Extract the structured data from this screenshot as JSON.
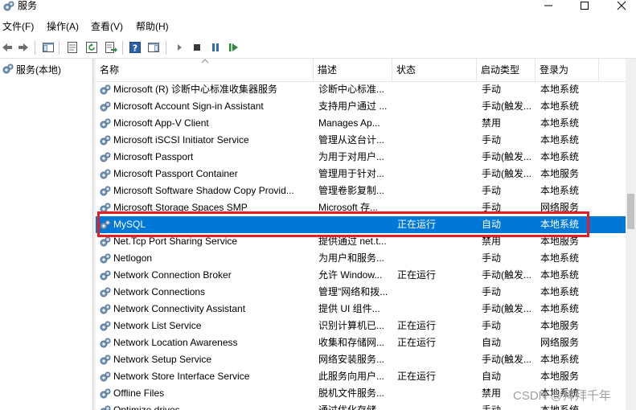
{
  "window": {
    "title": "服务"
  },
  "menu": [
    "文件(F)",
    "操作(A)",
    "查看(V)",
    "帮助(H)"
  ],
  "toolbar": {
    "icons": [
      "back-arrow-icon",
      "forward-arrow-icon",
      "show-hide-tree-icon",
      "properties-icon",
      "refresh-icon",
      "export-list-icon",
      "help-icon",
      "show-hide-action-pane-icon",
      "start-service-icon",
      "stop-service-icon",
      "pause-service-icon",
      "restart-service-icon"
    ]
  },
  "tree": {
    "root_label": "服务(本地)"
  },
  "columns": {
    "name": "名称",
    "desc": "描述",
    "status": "状态",
    "start": "启动类型",
    "logon": "登录为"
  },
  "services": [
    {
      "name": "Microsoft (R) 诊断中心标准收集器服务",
      "desc": "诊断中心标准...",
      "status": "",
      "start": "手动",
      "logon": "本地系统"
    },
    {
      "name": "Microsoft Account Sign-in Assistant",
      "desc": "支持用户通过 ...",
      "status": "",
      "start": "手动(触发...",
      "logon": "本地系统"
    },
    {
      "name": "Microsoft App-V Client",
      "desc": "Manages Ap...",
      "status": "",
      "start": "禁用",
      "logon": "本地系统"
    },
    {
      "name": "Microsoft iSCSI Initiator Service",
      "desc": "管理从这台计...",
      "status": "",
      "start": "手动",
      "logon": "本地系统"
    },
    {
      "name": "Microsoft Passport",
      "desc": "为用于对用户...",
      "status": "",
      "start": "手动(触发...",
      "logon": "本地系统"
    },
    {
      "name": "Microsoft Passport Container",
      "desc": "管理用于针对...",
      "status": "",
      "start": "手动(触发...",
      "logon": "本地服务"
    },
    {
      "name": "Microsoft Software Shadow Copy Provid...",
      "desc": "管理卷影复制...",
      "status": "",
      "start": "手动",
      "logon": "本地系统"
    },
    {
      "name": "Microsoft Storage Spaces SMP",
      "desc": "Microsoft 存...",
      "status": "",
      "start": "手动",
      "logon": "网络服务"
    },
    {
      "name": "MySQL",
      "desc": "",
      "status": "正在运行",
      "start": "自动",
      "logon": "本地系统"
    },
    {
      "name": "Net.Tcp Port Sharing Service",
      "desc": "提供通过 net.t...",
      "status": "",
      "start": "禁用",
      "logon": "本地服务"
    },
    {
      "name": "Netlogon",
      "desc": "为用户和服务...",
      "status": "",
      "start": "手动",
      "logon": "本地系统"
    },
    {
      "name": "Network Connection Broker",
      "desc": "允许 Window...",
      "status": "正在运行",
      "start": "手动(触发...",
      "logon": "本地系统"
    },
    {
      "name": "Network Connections",
      "desc": "管理\"网络和拨...",
      "status": "",
      "start": "手动",
      "logon": "本地系统"
    },
    {
      "name": "Network Connectivity Assistant",
      "desc": "提供 UI 组件...",
      "status": "",
      "start": "手动(触发...",
      "logon": "本地系统"
    },
    {
      "name": "Network List Service",
      "desc": "识别计算机已...",
      "status": "正在运行",
      "start": "手动",
      "logon": "本地服务"
    },
    {
      "name": "Network Location Awareness",
      "desc": "收集和存储网...",
      "status": "正在运行",
      "start": "自动",
      "logon": "网络服务"
    },
    {
      "name": "Network Setup Service",
      "desc": "网络安装服务...",
      "status": "",
      "start": "手动(触发...",
      "logon": "本地系统"
    },
    {
      "name": "Network Store Interface Service",
      "desc": "此服务向用户...",
      "status": "正在运行",
      "start": "自动",
      "logon": "本地服务"
    },
    {
      "name": "Offline Files",
      "desc": "脱机文件服务...",
      "status": "",
      "start": "禁用",
      "logon": "本地系统"
    },
    {
      "name": "Optimize drives",
      "desc": "通过优化存储...",
      "status": "",
      "start": "手动",
      "logon": "本地系统"
    }
  ],
  "selected_service": "MySQL",
  "colors": {
    "selection": "#0078d7",
    "highlight_box": "#e81c24"
  },
  "watermark": "CSDN @拜拜千年"
}
